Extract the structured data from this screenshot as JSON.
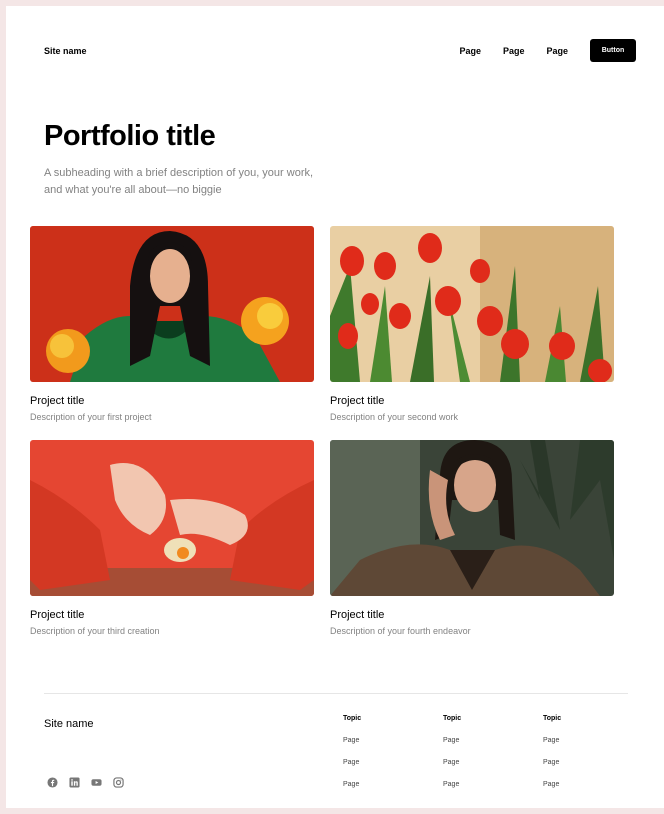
{
  "header": {
    "site_name": "Site name",
    "nav": [
      "Page",
      "Page",
      "Page"
    ],
    "button_label": "Button"
  },
  "hero": {
    "title": "Portfolio title",
    "subtitle": "A subheading with a brief description of you, your work, and what you're all about—no biggie"
  },
  "projects": [
    {
      "title": "Project title",
      "description": "Description of your first project"
    },
    {
      "title": "Project title",
      "description": "Description of your second work"
    },
    {
      "title": "Project title",
      "description": "Description of your third creation"
    },
    {
      "title": "Project title",
      "description": "Description of your fourth endeavor"
    }
  ],
  "footer": {
    "site_name": "Site name",
    "social_icons": [
      "facebook-icon",
      "linkedin-icon",
      "youtube-icon",
      "instagram-icon"
    ],
    "columns": [
      {
        "topic": "Topic",
        "links": [
          "Page",
          "Page",
          "Page"
        ]
      },
      {
        "topic": "Topic",
        "links": [
          "Page",
          "Page",
          "Page"
        ]
      },
      {
        "topic": "Topic",
        "links": [
          "Page",
          "Page",
          "Page"
        ]
      }
    ]
  },
  "colors": {
    "page_background": "#f4e6e6",
    "button_background": "#000000",
    "muted_text": "#828282"
  }
}
